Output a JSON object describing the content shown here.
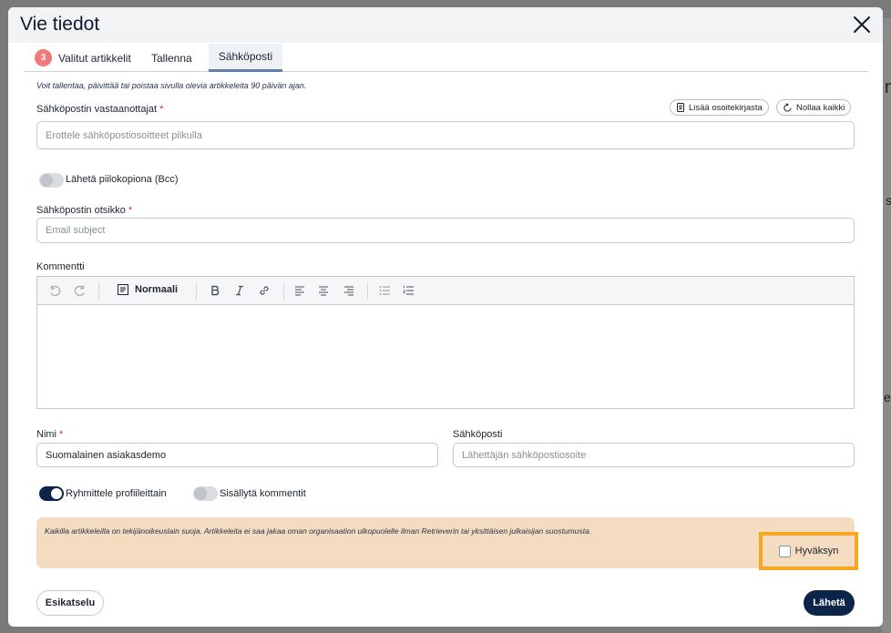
{
  "dialog": {
    "title": "Vie tiedot",
    "close_icon": "close-icon"
  },
  "tabs": [
    {
      "label": "Valitut artikkelit",
      "badge": "3"
    },
    {
      "label": "Tallenna"
    },
    {
      "label": "Sähköposti",
      "active": true
    }
  ],
  "info_note": "Voit tallentaa, päivittää tai poistaa sivulla olevia artikkeleita 90 päivän ajan.",
  "recipients": {
    "label": "Sähköpostin vastaanottajat",
    "required_mark": "*",
    "placeholder": "Erottele sähköpostiosoitteet pilkulla",
    "value": "",
    "add_from_addressbook": "Lisää osoitekirjasta",
    "reset_all": "Nollaa kaikki"
  },
  "bcc_toggle": {
    "label": "Lähetä piilokopiona (Bcc)",
    "on": false
  },
  "subject": {
    "label": "Sähköpostin otsikko",
    "required_mark": "*",
    "placeholder": "Email subject",
    "value": ""
  },
  "comment": {
    "label": "Kommentti",
    "style_select": "Normaali",
    "toolbar_icons": [
      "undo-icon",
      "redo-icon",
      "paragraph-style-icon",
      "bold-icon",
      "italic-icon",
      "link-icon",
      "align-left-icon",
      "align-center-icon",
      "align-right-icon",
      "bulleted-list-icon",
      "numbered-list-icon"
    ]
  },
  "name": {
    "label": "Nimi",
    "required_mark": "*",
    "value": "Suomalainen asiakasdemo"
  },
  "sender_email": {
    "label": "Sähköposti",
    "placeholder": "Lähettäjän sähköpostiosoite",
    "value": ""
  },
  "group_toggle": {
    "label": "Ryhmittele profiileittain",
    "on": true
  },
  "include_comments_toggle": {
    "label": "Sisällytä kommentit",
    "on": false
  },
  "notice": {
    "text": "Kaikilla artikkeleilla on tekijänoikeuslain suoja. Artikkeleita ei saa jakaa oman organisaation ulkopuolelle ilman Retrieverin tai yksittäisen julkaisijan suostumusta.",
    "accept_label": "Hyväksyn",
    "accepted": false,
    "highlight_color": "#f5a623"
  },
  "footer": {
    "preview_label": "Esikatselu",
    "send_label": "Lähetä"
  },
  "colors": {
    "primary": "#0b2447",
    "badge": "#f07878",
    "notice_bg": "#f4dcc0",
    "required": "#d0342c"
  }
}
